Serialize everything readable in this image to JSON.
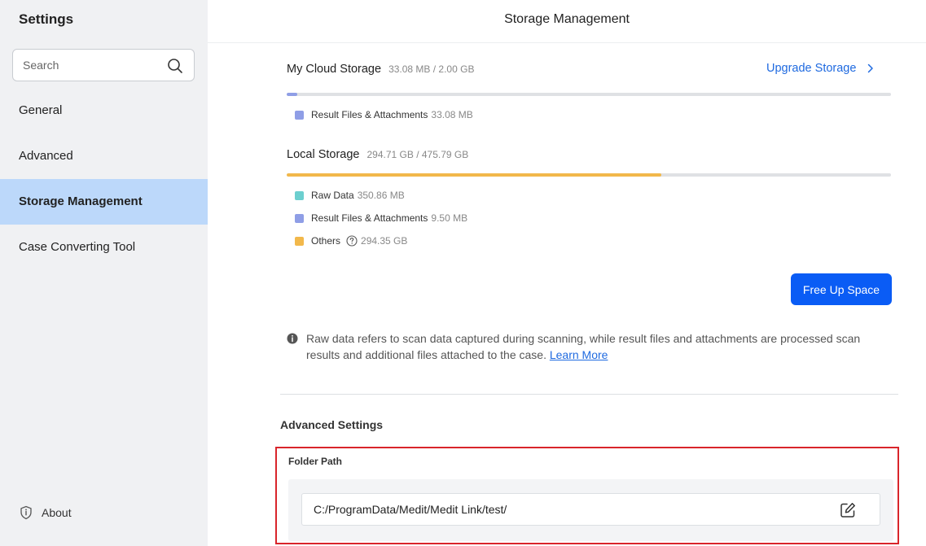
{
  "sidebar": {
    "title": "Settings",
    "search_placeholder": "Search",
    "items": [
      {
        "label": "General",
        "active": false
      },
      {
        "label": "Advanced",
        "active": false
      },
      {
        "label": "Storage Management",
        "active": true
      },
      {
        "label": "Case Converting Tool",
        "active": false
      }
    ],
    "about_label": "About"
  },
  "header": {
    "title": "Storage Management"
  },
  "cloud": {
    "title": "My Cloud Storage",
    "size": "33.08 MB / 2.00 GB",
    "usage_fraction": 0.017,
    "upgrade_label": "Upgrade Storage",
    "legend": [
      {
        "label": "Result Files & Attachments",
        "value": "33.08 MB",
        "color": "#8f9ee6"
      }
    ]
  },
  "local": {
    "title": "Local Storage",
    "size": "294.71 GB / 475.79 GB",
    "usage_fraction": 0.62,
    "legend": [
      {
        "label": "Raw Data",
        "value": "350.86 MB",
        "color": "#6ccfcf"
      },
      {
        "label": "Result Files & Attachments",
        "value": "9.50 MB",
        "color": "#8f9ee6"
      },
      {
        "label": "Others",
        "value": "294.35 GB",
        "color": "#f2b84b"
      }
    ]
  },
  "free_up_label": "Free Up Space",
  "info": {
    "text": "Raw data refers to scan data captured during scanning, while result files and attachments are processed scan results and additional files attached to the case.",
    "link": "Learn More"
  },
  "advanced": {
    "title": "Advanced Settings",
    "folder_label": "Folder Path",
    "folder_path": "C:/ProgramData/Medit/Medit Link/test/"
  },
  "colors": {
    "accent": "#0a5cf5",
    "link": "#1f6ae0",
    "sidebar_active": "#bcd8fa",
    "cloud_bar": "#8f9ee6",
    "local_bar": "#f2b84b",
    "highlight_border": "#d9252b"
  }
}
